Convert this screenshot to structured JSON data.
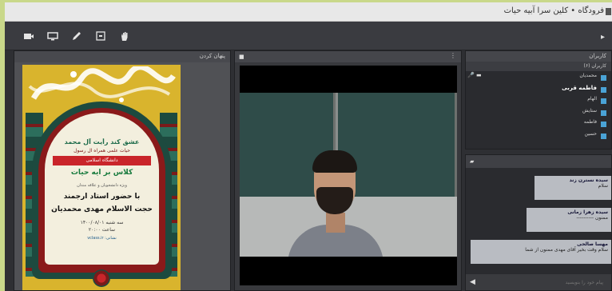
{
  "window": {
    "title": "فرودگاه • کلین سرا آبیه حیات"
  },
  "toolbar": {
    "buttons": [
      "camera-icon",
      "screen-share-icon",
      "pen-icon",
      "file-icon",
      "raise-hand-icon"
    ]
  },
  "whiteboard": {
    "header": "پنهان کردن",
    "poster": {
      "heading": "عشق کند رأیت آل محمد",
      "subtitle": "حیات علمی همراه آل رسول",
      "band": "دانشگاه اسلامی",
      "course": "کلاس بر آیه حیات",
      "note": "ویژه دانشجویان و علاقه مندان",
      "host_line1": "با حضور استاد ارجمند",
      "host_line2": "حجت الاسلام مهدی محمدیان",
      "date": "سه شنبه ۱۴۰۰/۰۸/۰۱",
      "time": "ساعت ۲۰:۰۰",
      "link": "نشانی: vclass.ir"
    }
  },
  "video": {
    "header": "",
    "menu": "⋮"
  },
  "participants": {
    "header": "کاربران",
    "count_label": "کاربران (۶)",
    "users": [
      {
        "name": "محمدیان",
        "bold": false
      },
      {
        "name": "فاطمه قربی",
        "bold": true
      },
      {
        "name": "الهام",
        "bold": false
      },
      {
        "name": "ستایش",
        "bold": false
      },
      {
        "name": "فاطمه",
        "bold": false
      },
      {
        "name": "حسین",
        "bold": false
      }
    ]
  },
  "chat": {
    "header": "",
    "messages": [
      {
        "name": "سیده نسترن زند",
        "text": "سلام"
      },
      {
        "name": "سیده زهرا زمانی",
        "text": "ممنون ----------"
      },
      {
        "name": "مهسا صالحی",
        "text": "سلام وقت بخیر آقای مهدی ممنون از شما"
      }
    ],
    "input_placeholder": "پیام خود را بنویسید"
  },
  "colors": {
    "accent": "#4aa3d6",
    "frame": "#c9d88a"
  }
}
